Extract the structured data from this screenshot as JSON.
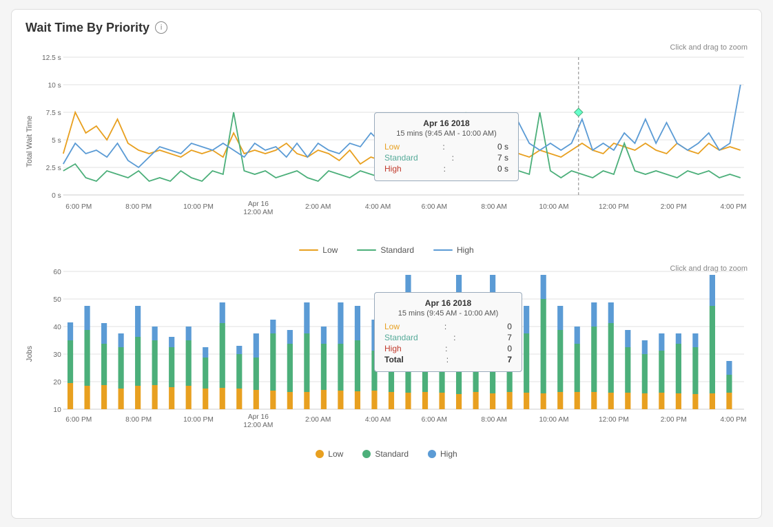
{
  "title": "Wait Time By Priority",
  "zoomHint": "Click and drag to zoom",
  "infoIcon": "i",
  "lineChart": {
    "yAxisLabel": "Total Wait Time",
    "yAxisTicks": [
      "12.5 s",
      "10 s",
      "7.5 s",
      "5 s",
      "2.5 s",
      "0 s"
    ],
    "xAxisLabels": [
      {
        "text": "6:00 PM",
        "twoLine": false
      },
      {
        "text": "8:00 PM",
        "twoLine": false
      },
      {
        "text": "10:00 PM",
        "twoLine": false
      },
      {
        "text": "Apr 16\n12:00 AM",
        "twoLine": true
      },
      {
        "text": "2:00 AM",
        "twoLine": false
      },
      {
        "text": "4:00 AM",
        "twoLine": false
      },
      {
        "text": "6:00 AM",
        "twoLine": false
      },
      {
        "text": "8:00 AM",
        "twoLine": false
      },
      {
        "text": "10:00 AM",
        "twoLine": false
      },
      {
        "text": "12:00 PM",
        "twoLine": false
      },
      {
        "text": "2:00 PM",
        "twoLine": false
      },
      {
        "text": "4:00 PM",
        "twoLine": false
      }
    ],
    "tooltip": {
      "date": "Apr 16 2018",
      "period": "15 mins (9:45 AM - 10:00 AM)",
      "low": "0 s",
      "standard": "7 s",
      "high": "0 s"
    }
  },
  "legend1": {
    "items": [
      {
        "label": "Low",
        "color": "#e8a020"
      },
      {
        "label": "Standard",
        "color": "#4caf7a"
      },
      {
        "label": "High",
        "color": "#5b9bd5"
      }
    ]
  },
  "barChart": {
    "yAxisLabel": "Jobs",
    "yAxisTicks": [
      "60",
      "40",
      "20",
      "0"
    ],
    "xAxisLabels": [
      {
        "text": "6:00 PM",
        "twoLine": false
      },
      {
        "text": "8:00 PM",
        "twoLine": false
      },
      {
        "text": "10:00 PM",
        "twoLine": false
      },
      {
        "text": "Apr 16\n12:00 AM",
        "twoLine": true
      },
      {
        "text": "2:00 AM",
        "twoLine": false
      },
      {
        "text": "4:00 AM",
        "twoLine": false
      },
      {
        "text": "6:00 AM",
        "twoLine": false
      },
      {
        "text": "8:00 AM",
        "twoLine": false
      },
      {
        "text": "10:00 AM",
        "twoLine": false
      },
      {
        "text": "12:00 PM",
        "twoLine": false
      },
      {
        "text": "2:00 PM",
        "twoLine": false
      },
      {
        "text": "4:00 PM",
        "twoLine": false
      }
    ],
    "tooltip": {
      "date": "Apr 16 2018",
      "period": "15 mins (9:45 AM - 10:00 AM)",
      "low": "0",
      "standard": "7",
      "high": "0",
      "total": "7"
    }
  },
  "legend2": {
    "items": [
      {
        "label": "Low",
        "color": "#e8a020"
      },
      {
        "label": "Standard",
        "color": "#4caf7a"
      },
      {
        "label": "High",
        "color": "#5b9bd5"
      }
    ]
  },
  "colors": {
    "low": "#e8a020",
    "standard": "#4caf7a",
    "high": "#5b9bd5",
    "tooltipBorder": "#9ab",
    "gridLine": "#e0e0e0"
  }
}
